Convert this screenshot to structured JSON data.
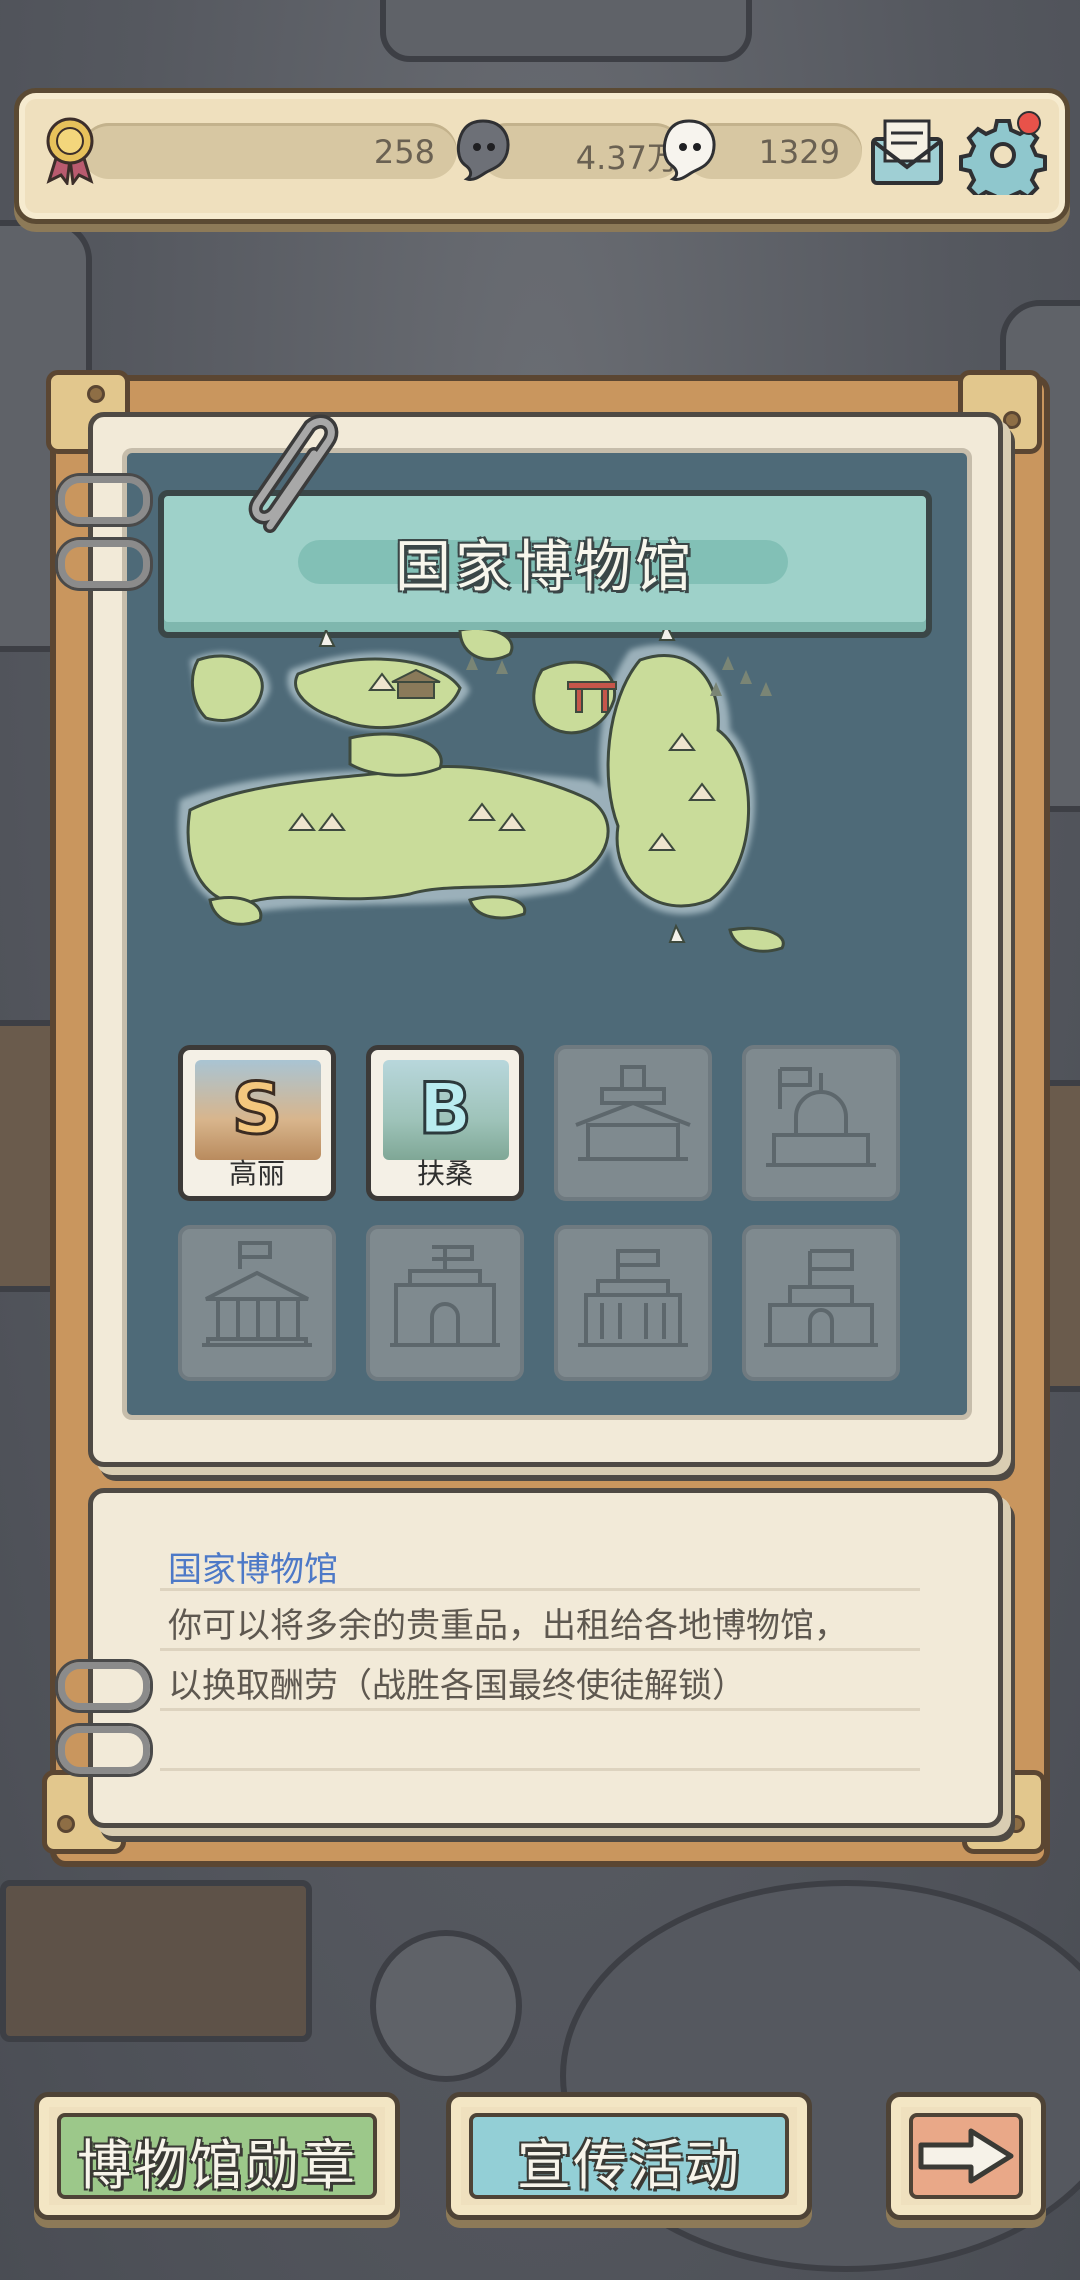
{
  "topbar": {
    "medal_count": "258",
    "dark_soul_count": "4.37万",
    "light_soul_count": "1329",
    "icons": [
      "medal-icon",
      "dark-soul-icon",
      "light-soul-icon",
      "mail-icon",
      "settings-gear-icon"
    ],
    "notification_dot_color": "#e8524a"
  },
  "panel": {
    "title": "国家博物馆",
    "tiles": [
      {
        "grade": "S",
        "name": "高丽",
        "unlocked": true,
        "grade_color": "#f4c77e"
      },
      {
        "grade": "B",
        "name": "扶桑",
        "unlocked": true,
        "grade_color": "#b9ecf0"
      },
      {
        "grade": "",
        "name": "",
        "unlocked": false
      },
      {
        "grade": "",
        "name": "",
        "unlocked": false
      },
      {
        "grade": "",
        "name": "",
        "unlocked": false
      },
      {
        "grade": "",
        "name": "",
        "unlocked": false
      },
      {
        "grade": "",
        "name": "",
        "unlocked": false
      },
      {
        "grade": "",
        "name": "",
        "unlocked": false
      }
    ]
  },
  "description": {
    "title": "国家博物馆",
    "line1": "你可以将多余的贵重品，出租给各地博物馆，",
    "line2": "以换取酬劳（战胜各国最终使徒解锁）"
  },
  "buttons": {
    "medal_label": "博物馆勋章",
    "promo_label": "宣传活动",
    "next_icon": "arrow-right-icon"
  }
}
